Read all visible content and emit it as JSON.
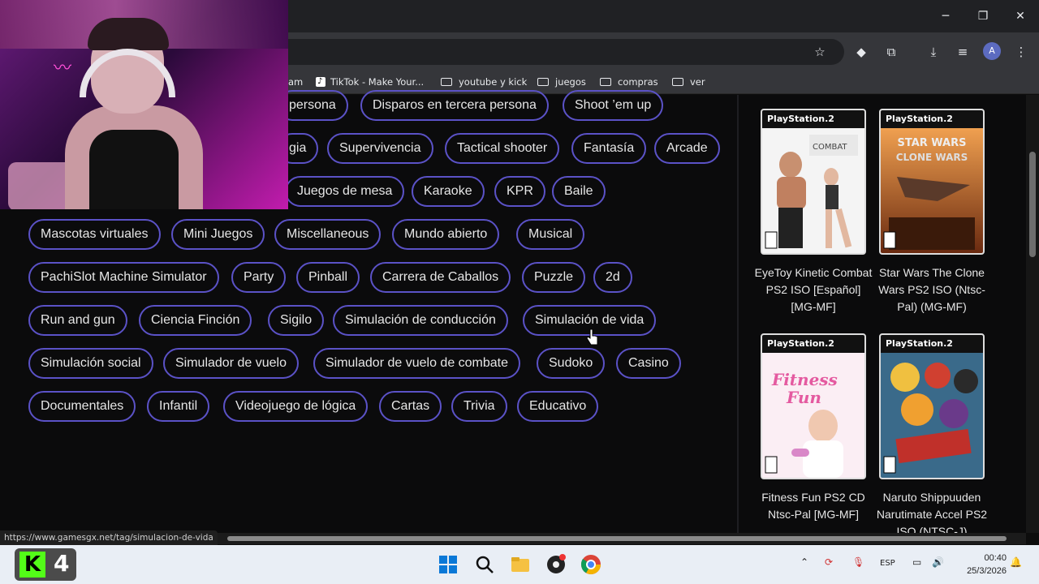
{
  "window": {
    "minimize": "─",
    "maximize": "❐",
    "close": "✕"
  },
  "bookmarks": [
    {
      "label": "am",
      "kind": "link"
    },
    {
      "label": "TikTok - Make Your...",
      "kind": "tiktok"
    },
    {
      "label": "youtube y kick",
      "kind": "folder"
    },
    {
      "label": "juegos",
      "kind": "folder"
    },
    {
      "label": "compras",
      "kind": "folder"
    },
    {
      "label": "ver",
      "kind": "folder"
    }
  ],
  "tags": [
    "persona",
    "Disparos en tercera persona",
    "Shoot ’em up",
    "gia",
    "Supervivencia",
    "Tactical shooter",
    "Fantasía",
    "Arcade",
    "Juegos de mesa",
    "Karaoke",
    "KPR",
    "Baile",
    "Mascotas virtuales",
    "Mini Juegos",
    "Miscellaneous",
    "Mundo abierto",
    "Musical",
    "PachiSlot Machine Simulator",
    "Party",
    "Pinball",
    "Carrera de Caballos",
    "Puzzle",
    "2d",
    "Run and gun",
    "Ciencia Finción",
    "Sigilo",
    "Simulación de conducción",
    "Simulación de vida",
    "Simulación social",
    "Simulador de vuelo",
    "Simulador de vuelo de combate",
    "Sudoko",
    "Casino",
    "Documentales",
    "Infantil",
    "Videojuego de lógica",
    "Cartas",
    "Trivia",
    "Educativo"
  ],
  "games": [
    {
      "title": "EyeToy Kinetic Combat PS2 ISO [Español] [MG-MF]",
      "platform": "PlayStation.2",
      "art": "kinetic"
    },
    {
      "title": "Star Wars The Clone Wars PS2 ISO (Ntsc-Pal) (MG-MF)",
      "platform": "PlayStation.2",
      "art": "starwars"
    },
    {
      "title": "Fitness Fun PS2 CD Ntsc-Pal [MG-MF]",
      "platform": "PlayStation.2",
      "art": "fitness"
    },
    {
      "title": "Naruto Shippuuden Narutimate Accel PS2 ISO (NTSC-J)",
      "platform": "PlayStation.2",
      "art": "naruto"
    }
  ],
  "status_url": "https://www.gamesgx.net/tag/simulacion-de-vida",
  "taskbar": {
    "kick_count": "4",
    "lang": "ESP",
    "time": "00:40",
    "date": "25/3/2026"
  },
  "profile_initial": "A"
}
